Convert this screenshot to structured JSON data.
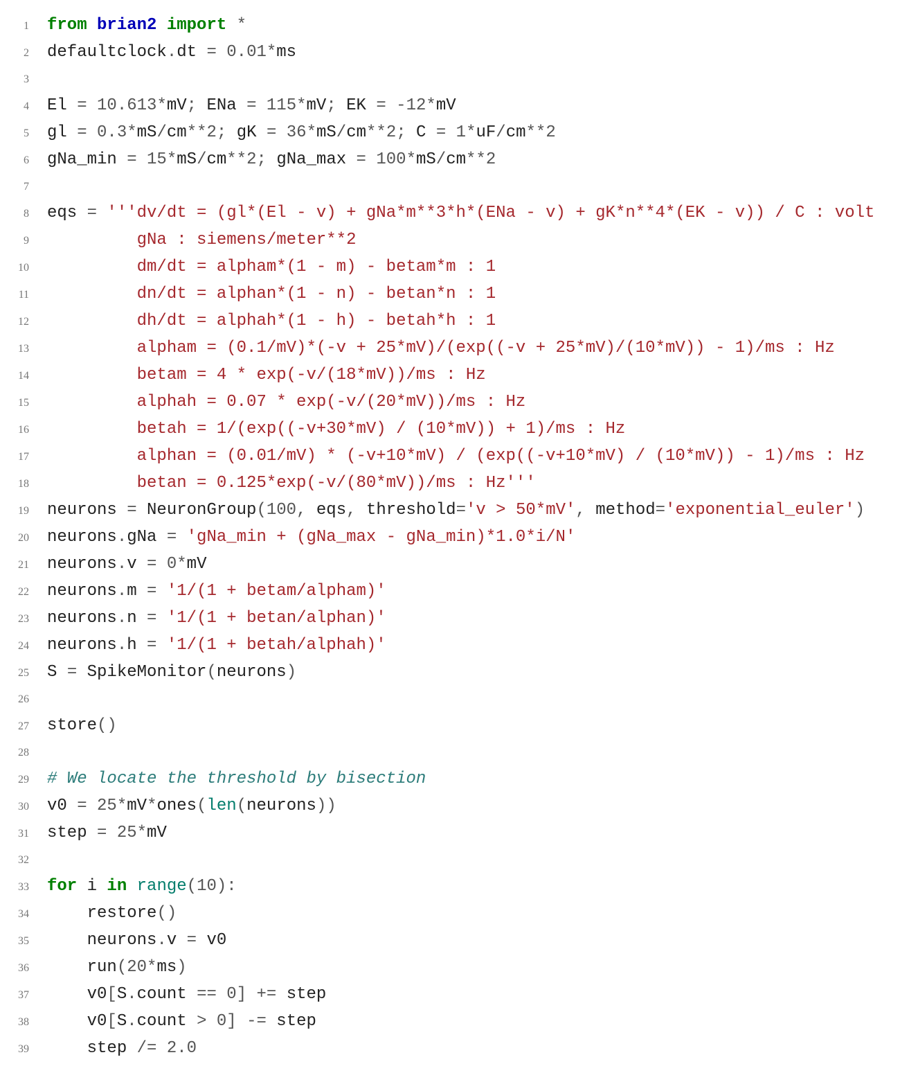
{
  "code": {
    "lines": [
      {
        "n": "1",
        "tokens": [
          {
            "cls": "kw-green",
            "t": "from "
          },
          {
            "cls": "kw-blue",
            "t": "brian2"
          },
          {
            "cls": "kw-green",
            "t": " import"
          },
          {
            "cls": "op",
            "t": " *"
          }
        ]
      },
      {
        "n": "2",
        "tokens": [
          {
            "cls": "",
            "t": "defaultclock"
          },
          {
            "cls": "op",
            "t": "."
          },
          {
            "cls": "",
            "t": "dt "
          },
          {
            "cls": "op",
            "t": "= "
          },
          {
            "cls": "num",
            "t": "0.01"
          },
          {
            "cls": "op",
            "t": "*"
          },
          {
            "cls": "",
            "t": "ms"
          }
        ]
      },
      {
        "n": "3",
        "tokens": [
          {
            "cls": "",
            "t": ""
          }
        ]
      },
      {
        "n": "4",
        "tokens": [
          {
            "cls": "",
            "t": "El "
          },
          {
            "cls": "op",
            "t": "= "
          },
          {
            "cls": "num",
            "t": "10.613"
          },
          {
            "cls": "op",
            "t": "*"
          },
          {
            "cls": "",
            "t": "mV"
          },
          {
            "cls": "op",
            "t": "; "
          },
          {
            "cls": "",
            "t": "ENa "
          },
          {
            "cls": "op",
            "t": "= "
          },
          {
            "cls": "num",
            "t": "115"
          },
          {
            "cls": "op",
            "t": "*"
          },
          {
            "cls": "",
            "t": "mV"
          },
          {
            "cls": "op",
            "t": "; "
          },
          {
            "cls": "",
            "t": "EK "
          },
          {
            "cls": "op",
            "t": "= -"
          },
          {
            "cls": "num",
            "t": "12"
          },
          {
            "cls": "op",
            "t": "*"
          },
          {
            "cls": "",
            "t": "mV"
          }
        ]
      },
      {
        "n": "5",
        "tokens": [
          {
            "cls": "",
            "t": "gl "
          },
          {
            "cls": "op",
            "t": "= "
          },
          {
            "cls": "num",
            "t": "0.3"
          },
          {
            "cls": "op",
            "t": "*"
          },
          {
            "cls": "",
            "t": "mS"
          },
          {
            "cls": "op",
            "t": "/"
          },
          {
            "cls": "",
            "t": "cm"
          },
          {
            "cls": "op",
            "t": "**"
          },
          {
            "cls": "num",
            "t": "2"
          },
          {
            "cls": "op",
            "t": "; "
          },
          {
            "cls": "",
            "t": "gK "
          },
          {
            "cls": "op",
            "t": "= "
          },
          {
            "cls": "num",
            "t": "36"
          },
          {
            "cls": "op",
            "t": "*"
          },
          {
            "cls": "",
            "t": "mS"
          },
          {
            "cls": "op",
            "t": "/"
          },
          {
            "cls": "",
            "t": "cm"
          },
          {
            "cls": "op",
            "t": "**"
          },
          {
            "cls": "num",
            "t": "2"
          },
          {
            "cls": "op",
            "t": "; "
          },
          {
            "cls": "",
            "t": "C "
          },
          {
            "cls": "op",
            "t": "= "
          },
          {
            "cls": "num",
            "t": "1"
          },
          {
            "cls": "op",
            "t": "*"
          },
          {
            "cls": "",
            "t": "uF"
          },
          {
            "cls": "op",
            "t": "/"
          },
          {
            "cls": "",
            "t": "cm"
          },
          {
            "cls": "op",
            "t": "**"
          },
          {
            "cls": "num",
            "t": "2"
          }
        ]
      },
      {
        "n": "6",
        "tokens": [
          {
            "cls": "",
            "t": "gNa_min "
          },
          {
            "cls": "op",
            "t": "= "
          },
          {
            "cls": "num",
            "t": "15"
          },
          {
            "cls": "op",
            "t": "*"
          },
          {
            "cls": "",
            "t": "mS"
          },
          {
            "cls": "op",
            "t": "/"
          },
          {
            "cls": "",
            "t": "cm"
          },
          {
            "cls": "op",
            "t": "**"
          },
          {
            "cls": "num",
            "t": "2"
          },
          {
            "cls": "op",
            "t": "; "
          },
          {
            "cls": "",
            "t": "gNa_max "
          },
          {
            "cls": "op",
            "t": "= "
          },
          {
            "cls": "num",
            "t": "100"
          },
          {
            "cls": "op",
            "t": "*"
          },
          {
            "cls": "",
            "t": "mS"
          },
          {
            "cls": "op",
            "t": "/"
          },
          {
            "cls": "",
            "t": "cm"
          },
          {
            "cls": "op",
            "t": "**"
          },
          {
            "cls": "num",
            "t": "2"
          }
        ]
      },
      {
        "n": "7",
        "tokens": [
          {
            "cls": "",
            "t": ""
          }
        ]
      },
      {
        "n": "8",
        "tokens": [
          {
            "cls": "",
            "t": "eqs "
          },
          {
            "cls": "op",
            "t": "= "
          },
          {
            "cls": "str",
            "t": "'''dv/dt = (gl*(El - v) + gNa*m**3*h*(ENa - v) + gK*n**4*(EK - v)) / C : volt"
          }
        ]
      },
      {
        "n": "9",
        "tokens": [
          {
            "cls": "str",
            "t": "         gNa : siemens/meter**2"
          }
        ]
      },
      {
        "n": "10",
        "tokens": [
          {
            "cls": "str",
            "t": "         dm/dt = alpham*(1 - m) - betam*m : 1"
          }
        ]
      },
      {
        "n": "11",
        "tokens": [
          {
            "cls": "str",
            "t": "         dn/dt = alphan*(1 - n) - betan*n : 1"
          }
        ]
      },
      {
        "n": "12",
        "tokens": [
          {
            "cls": "str",
            "t": "         dh/dt = alphah*(1 - h) - betah*h : 1"
          }
        ]
      },
      {
        "n": "13",
        "tokens": [
          {
            "cls": "str",
            "t": "         alpham = (0.1/mV)*(-v + 25*mV)/(exp((-v + 25*mV)/(10*mV)) - 1)/ms : Hz"
          }
        ]
      },
      {
        "n": "14",
        "tokens": [
          {
            "cls": "str",
            "t": "         betam = 4 * exp(-v/(18*mV))/ms : Hz"
          }
        ]
      },
      {
        "n": "15",
        "tokens": [
          {
            "cls": "str",
            "t": "         alphah = 0.07 * exp(-v/(20*mV))/ms : Hz"
          }
        ]
      },
      {
        "n": "16",
        "tokens": [
          {
            "cls": "str",
            "t": "         betah = 1/(exp((-v+30*mV) / (10*mV)) + 1)/ms : Hz"
          }
        ]
      },
      {
        "n": "17",
        "tokens": [
          {
            "cls": "str",
            "t": "         alphan = (0.01/mV) * (-v+10*mV) / (exp((-v+10*mV) / (10*mV)) - 1)/ms : Hz"
          }
        ]
      },
      {
        "n": "18",
        "tokens": [
          {
            "cls": "str",
            "t": "         betan = 0.125*exp(-v/(80*mV))/ms : Hz'''"
          }
        ]
      },
      {
        "n": "19",
        "tokens": [
          {
            "cls": "",
            "t": "neurons "
          },
          {
            "cls": "op",
            "t": "= "
          },
          {
            "cls": "",
            "t": "NeuronGroup"
          },
          {
            "cls": "op",
            "t": "("
          },
          {
            "cls": "num",
            "t": "100"
          },
          {
            "cls": "op",
            "t": ", "
          },
          {
            "cls": "",
            "t": "eqs"
          },
          {
            "cls": "op",
            "t": ", "
          },
          {
            "cls": "",
            "t": "threshold"
          },
          {
            "cls": "op",
            "t": "="
          },
          {
            "cls": "str",
            "t": "'v > 50*mV'"
          },
          {
            "cls": "op",
            "t": ", "
          },
          {
            "cls": "",
            "t": "method"
          },
          {
            "cls": "op",
            "t": "="
          },
          {
            "cls": "str",
            "t": "'exponential_euler'"
          },
          {
            "cls": "op",
            "t": ")"
          }
        ]
      },
      {
        "n": "20",
        "tokens": [
          {
            "cls": "",
            "t": "neurons"
          },
          {
            "cls": "op",
            "t": "."
          },
          {
            "cls": "",
            "t": "gNa "
          },
          {
            "cls": "op",
            "t": "= "
          },
          {
            "cls": "str",
            "t": "'gNa_min + (gNa_max - gNa_min)*1.0*i/N'"
          }
        ]
      },
      {
        "n": "21",
        "tokens": [
          {
            "cls": "",
            "t": "neurons"
          },
          {
            "cls": "op",
            "t": "."
          },
          {
            "cls": "",
            "t": "v "
          },
          {
            "cls": "op",
            "t": "= "
          },
          {
            "cls": "num",
            "t": "0"
          },
          {
            "cls": "op",
            "t": "*"
          },
          {
            "cls": "",
            "t": "mV"
          }
        ]
      },
      {
        "n": "22",
        "tokens": [
          {
            "cls": "",
            "t": "neurons"
          },
          {
            "cls": "op",
            "t": "."
          },
          {
            "cls": "",
            "t": "m "
          },
          {
            "cls": "op",
            "t": "= "
          },
          {
            "cls": "str",
            "t": "'1/(1 + betam/alpham)'"
          }
        ]
      },
      {
        "n": "23",
        "tokens": [
          {
            "cls": "",
            "t": "neurons"
          },
          {
            "cls": "op",
            "t": "."
          },
          {
            "cls": "",
            "t": "n "
          },
          {
            "cls": "op",
            "t": "= "
          },
          {
            "cls": "str",
            "t": "'1/(1 + betan/alphan)'"
          }
        ]
      },
      {
        "n": "24",
        "tokens": [
          {
            "cls": "",
            "t": "neurons"
          },
          {
            "cls": "op",
            "t": "."
          },
          {
            "cls": "",
            "t": "h "
          },
          {
            "cls": "op",
            "t": "= "
          },
          {
            "cls": "str",
            "t": "'1/(1 + betah/alphah)'"
          }
        ]
      },
      {
        "n": "25",
        "tokens": [
          {
            "cls": "",
            "t": "S "
          },
          {
            "cls": "op",
            "t": "= "
          },
          {
            "cls": "",
            "t": "SpikeMonitor"
          },
          {
            "cls": "op",
            "t": "("
          },
          {
            "cls": "",
            "t": "neurons"
          },
          {
            "cls": "op",
            "t": ")"
          }
        ]
      },
      {
        "n": "26",
        "tokens": [
          {
            "cls": "",
            "t": ""
          }
        ]
      },
      {
        "n": "27",
        "tokens": [
          {
            "cls": "",
            "t": "store"
          },
          {
            "cls": "op",
            "t": "()"
          }
        ]
      },
      {
        "n": "28",
        "tokens": [
          {
            "cls": "",
            "t": ""
          }
        ]
      },
      {
        "n": "29",
        "tokens": [
          {
            "cls": "comment",
            "t": "# We locate the threshold by bisection"
          }
        ]
      },
      {
        "n": "30",
        "tokens": [
          {
            "cls": "",
            "t": "v0 "
          },
          {
            "cls": "op",
            "t": "= "
          },
          {
            "cls": "num",
            "t": "25"
          },
          {
            "cls": "op",
            "t": "*"
          },
          {
            "cls": "",
            "t": "mV"
          },
          {
            "cls": "op",
            "t": "*"
          },
          {
            "cls": "",
            "t": "ones"
          },
          {
            "cls": "op",
            "t": "("
          },
          {
            "cls": "builtin",
            "t": "len"
          },
          {
            "cls": "op",
            "t": "("
          },
          {
            "cls": "",
            "t": "neurons"
          },
          {
            "cls": "op",
            "t": "))"
          }
        ]
      },
      {
        "n": "31",
        "tokens": [
          {
            "cls": "",
            "t": "step "
          },
          {
            "cls": "op",
            "t": "= "
          },
          {
            "cls": "num",
            "t": "25"
          },
          {
            "cls": "op",
            "t": "*"
          },
          {
            "cls": "",
            "t": "mV"
          }
        ]
      },
      {
        "n": "32",
        "tokens": [
          {
            "cls": "",
            "t": ""
          }
        ]
      },
      {
        "n": "33",
        "tokens": [
          {
            "cls": "kw-green",
            "t": "for "
          },
          {
            "cls": "",
            "t": "i "
          },
          {
            "cls": "kw-green",
            "t": "in "
          },
          {
            "cls": "builtin",
            "t": "range"
          },
          {
            "cls": "op",
            "t": "("
          },
          {
            "cls": "num",
            "t": "10"
          },
          {
            "cls": "op",
            "t": "):"
          }
        ]
      },
      {
        "n": "34",
        "tokens": [
          {
            "cls": "",
            "t": "    restore"
          },
          {
            "cls": "op",
            "t": "()"
          }
        ]
      },
      {
        "n": "35",
        "tokens": [
          {
            "cls": "",
            "t": "    neurons"
          },
          {
            "cls": "op",
            "t": "."
          },
          {
            "cls": "",
            "t": "v "
          },
          {
            "cls": "op",
            "t": "= "
          },
          {
            "cls": "",
            "t": "v0"
          }
        ]
      },
      {
        "n": "36",
        "tokens": [
          {
            "cls": "",
            "t": "    run"
          },
          {
            "cls": "op",
            "t": "("
          },
          {
            "cls": "num",
            "t": "20"
          },
          {
            "cls": "op",
            "t": "*"
          },
          {
            "cls": "",
            "t": "ms"
          },
          {
            "cls": "op",
            "t": ")"
          }
        ]
      },
      {
        "n": "37",
        "tokens": [
          {
            "cls": "",
            "t": "    v0"
          },
          {
            "cls": "op",
            "t": "["
          },
          {
            "cls": "",
            "t": "S"
          },
          {
            "cls": "op",
            "t": "."
          },
          {
            "cls": "",
            "t": "count "
          },
          {
            "cls": "op",
            "t": "== "
          },
          {
            "cls": "num",
            "t": "0"
          },
          {
            "cls": "op",
            "t": "] += "
          },
          {
            "cls": "",
            "t": "step"
          }
        ]
      },
      {
        "n": "38",
        "tokens": [
          {
            "cls": "",
            "t": "    v0"
          },
          {
            "cls": "op",
            "t": "["
          },
          {
            "cls": "",
            "t": "S"
          },
          {
            "cls": "op",
            "t": "."
          },
          {
            "cls": "",
            "t": "count "
          },
          {
            "cls": "op",
            "t": "> "
          },
          {
            "cls": "num",
            "t": "0"
          },
          {
            "cls": "op",
            "t": "] -= "
          },
          {
            "cls": "",
            "t": "step"
          }
        ]
      },
      {
        "n": "39",
        "tokens": [
          {
            "cls": "",
            "t": "    step "
          },
          {
            "cls": "op",
            "t": "/= "
          },
          {
            "cls": "num",
            "t": "2.0"
          }
        ]
      }
    ]
  }
}
